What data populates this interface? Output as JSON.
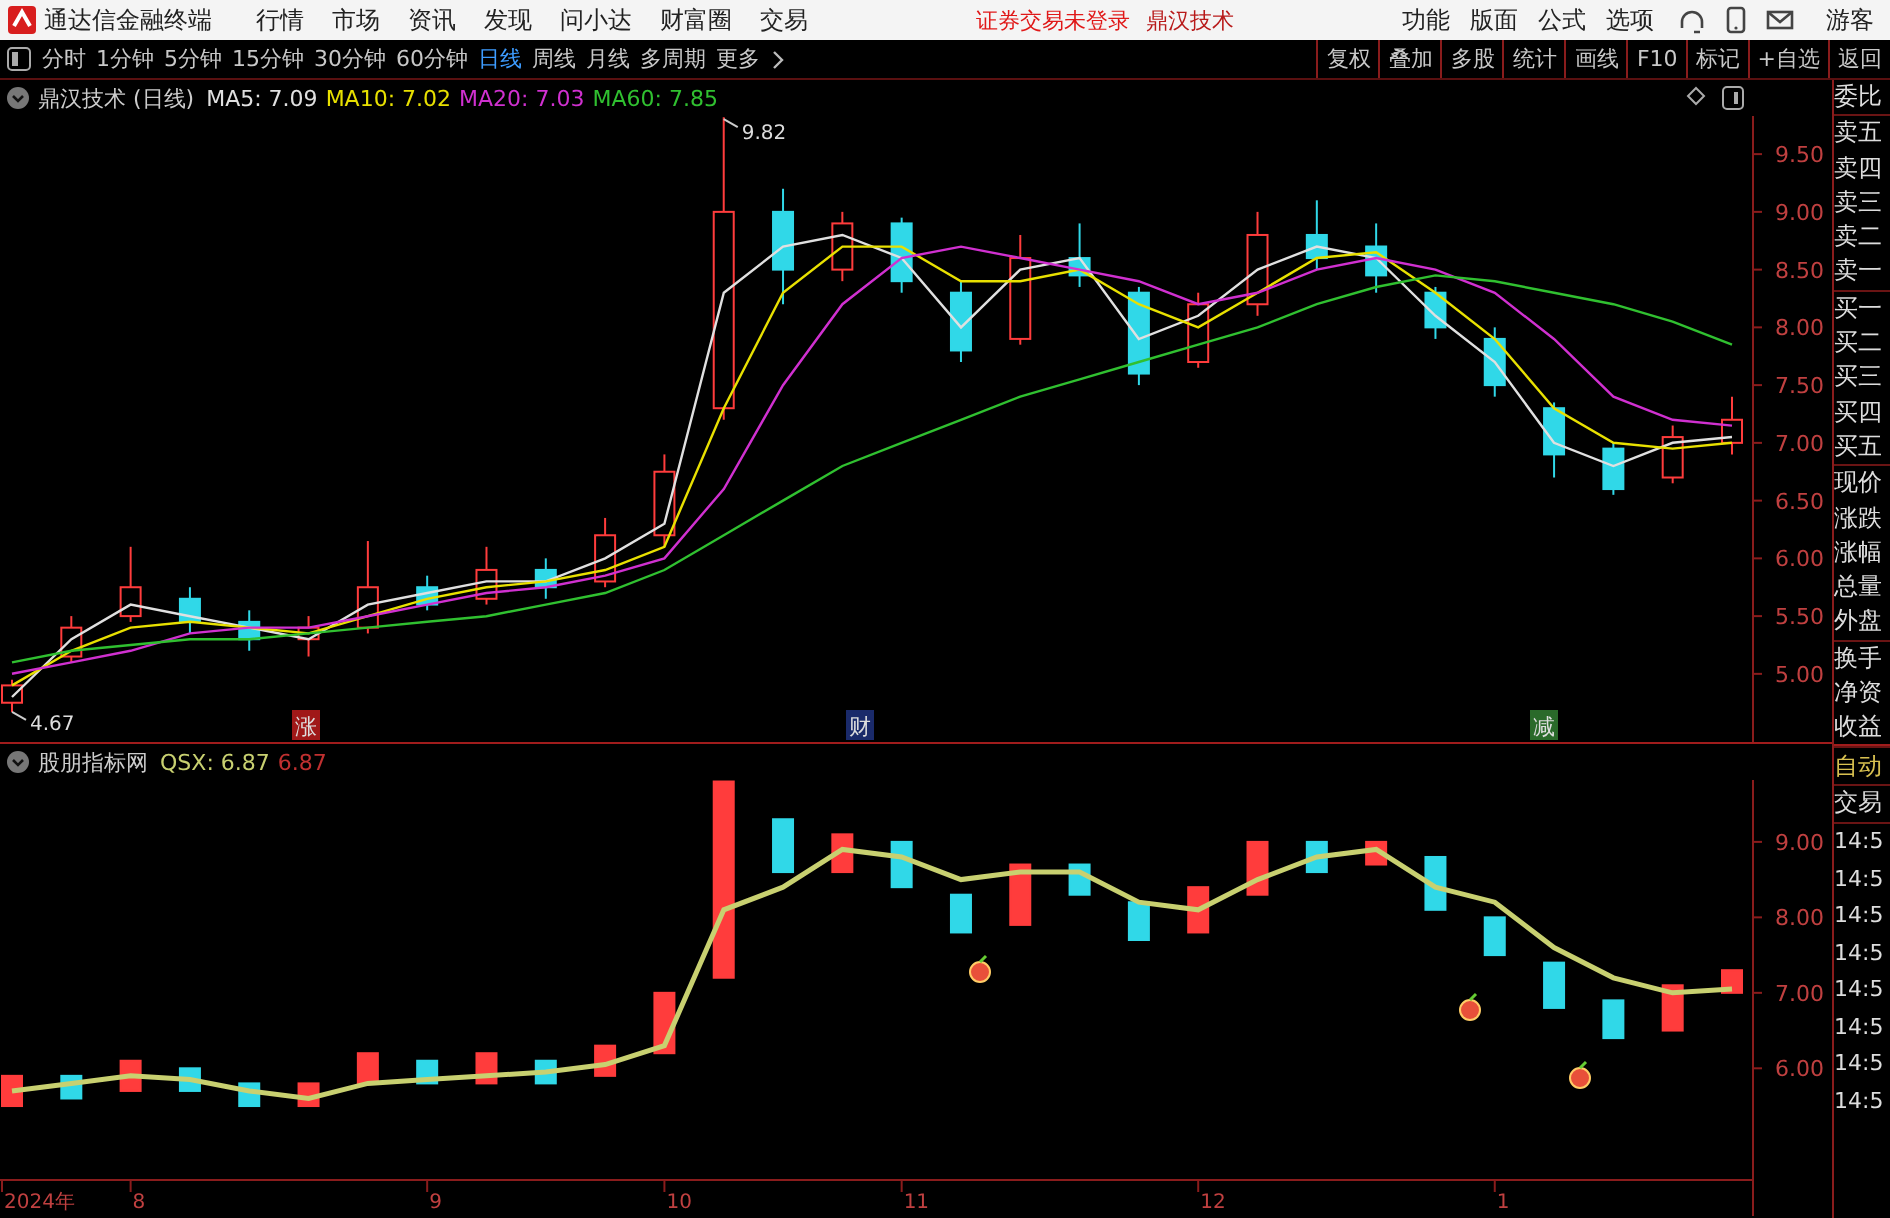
{
  "app": {
    "title": "通达信金融终端"
  },
  "menu": [
    "行情",
    "市场",
    "资讯",
    "发现",
    "问小达",
    "财富圈",
    "交易"
  ],
  "notice": [
    {
      "text": "证券交易未登录",
      "kind": "status"
    },
    {
      "text": "鼎汉技术",
      "kind": "stock"
    }
  ],
  "right_menu": [
    "功能",
    "版面",
    "公式",
    "选项"
  ],
  "user": "游客",
  "periods": [
    {
      "label": "分时",
      "selected": false
    },
    {
      "label": "1分钟",
      "selected": false
    },
    {
      "label": "5分钟",
      "selected": false
    },
    {
      "label": "15分钟",
      "selected": false
    },
    {
      "label": "30分钟",
      "selected": false
    },
    {
      "label": "60分钟",
      "selected": false
    },
    {
      "label": "日线",
      "selected": true
    },
    {
      "label": "周线",
      "selected": false
    },
    {
      "label": "月线",
      "selected": false
    },
    {
      "label": "多周期",
      "selected": false
    }
  ],
  "more": "更多",
  "tool_buttons": [
    "复权",
    "叠加",
    "多股",
    "统计",
    "画线",
    "F10",
    "标记",
    "+自选",
    "返回"
  ],
  "price_panel": {
    "title": "鼎汉技术 (日线)",
    "legend": [
      {
        "value": ": 7.09"
      },
      {
        "value": ": 7.02"
      },
      {
        "value": ": 7.03"
      },
      {
        "value": ": 7.85"
      }
    ],
    "high_label": "9.82",
    "low_label": "4.67",
    "events": [
      {
        "label": "涨",
        "color": "#a01818"
      },
      {
        "label": "财",
        "color": "#1a2a6a"
      },
      {
        "label": "减",
        "color": "#2a6a2a"
      }
    ],
    "chart_data": {
      "type": "candlestick",
      "categories": [
        null,
        null,
        null,
        null,
        null,
        null,
        null,
        null,
        null,
        null,
        null,
        null,
        null,
        null,
        null,
        null,
        null,
        null,
        null,
        null,
        null,
        null,
        null,
        null,
        null,
        null,
        null,
        null,
        null,
        null
      ],
      "ylim": [
        4.41,
        9.83
      ],
      "yticks": [
        {
          "value": 9.5,
          "label": "9.50"
        },
        {
          "value": 9,
          "label": "9.00"
        },
        {
          "value": 8.5,
          "label": "8.50"
        },
        {
          "value": 8,
          "label": "8.00"
        },
        {
          "value": 7.5,
          "label": "7.50"
        },
        {
          "value": 7,
          "label": "7.00"
        },
        {
          "value": 6.5,
          "label": "6.50"
        },
        {
          "value": 6,
          "label": "6.00"
        },
        {
          "value": 5.5,
          "label": "5.50"
        },
        {
          "value": 5,
          "label": "5.00"
        }
      ],
      "ohlc": [
        [
          4.75,
          4.95,
          4.67,
          4.9
        ],
        [
          5.15,
          5.5,
          5.1,
          5.4
        ],
        [
          5.5,
          6.1,
          5.45,
          5.75
        ],
        [
          5.65,
          5.75,
          5.35,
          5.45
        ],
        [
          5.45,
          5.55,
          5.2,
          5.3
        ],
        [
          5.3,
          5.5,
          5.15,
          5.4
        ],
        [
          5.4,
          6.15,
          5.35,
          5.75
        ],
        [
          5.75,
          5.85,
          5.55,
          5.6
        ],
        [
          5.65,
          6.1,
          5.6,
          5.9
        ],
        [
          5.9,
          6.0,
          5.65,
          5.75
        ],
        [
          5.8,
          6.35,
          5.75,
          6.2
        ],
        [
          6.2,
          6.9,
          6.1,
          6.75
        ],
        [
          7.3,
          9.82,
          7.2,
          9.0
        ],
        [
          9.0,
          9.2,
          8.2,
          8.5
        ],
        [
          8.5,
          9.0,
          8.4,
          8.9
        ],
        [
          8.9,
          8.95,
          8.3,
          8.4
        ],
        [
          8.3,
          8.4,
          7.7,
          7.8
        ],
        [
          7.9,
          8.8,
          7.85,
          8.6
        ],
        [
          8.6,
          8.9,
          8.35,
          8.45
        ],
        [
          8.3,
          8.35,
          7.5,
          7.6
        ],
        [
          7.7,
          8.3,
          7.65,
          8.2
        ],
        [
          8.2,
          9.0,
          8.1,
          8.8
        ],
        [
          8.8,
          9.1,
          8.5,
          8.6
        ],
        [
          8.7,
          8.9,
          8.3,
          8.45
        ],
        [
          8.3,
          8.35,
          7.9,
          8.0
        ],
        [
          7.9,
          8.0,
          7.4,
          7.5
        ],
        [
          7.3,
          7.35,
          6.7,
          6.9
        ],
        [
          6.95,
          7.0,
          6.55,
          6.6
        ],
        [
          6.7,
          7.15,
          6.65,
          7.05
        ],
        [
          7.0,
          7.4,
          6.9,
          7.2
        ]
      ],
      "series": [
        {
          "name": "MA5",
          "type": "line",
          "color": "#e0e0e0",
          "values": [
            4.8,
            5.3,
            5.6,
            5.5,
            5.4,
            5.3,
            5.6,
            5.7,
            5.8,
            5.8,
            6.0,
            6.3,
            8.3,
            8.7,
            8.8,
            8.6,
            8.0,
            8.5,
            8.6,
            7.9,
            8.1,
            8.5,
            8.7,
            8.6,
            8.1,
            7.7,
            7.0,
            6.8,
            7.0,
            7.05
          ]
        },
        {
          "name": "MA10",
          "type": "line",
          "color": "#e8e000",
          "values": [
            4.9,
            5.2,
            5.4,
            5.45,
            5.4,
            5.35,
            5.5,
            5.65,
            5.75,
            5.8,
            5.9,
            6.1,
            7.3,
            8.3,
            8.7,
            8.7,
            8.4,
            8.4,
            8.5,
            8.2,
            8.0,
            8.3,
            8.6,
            8.65,
            8.3,
            7.9,
            7.3,
            7.0,
            6.95,
            7.0
          ]
        },
        {
          "name": "MA20",
          "type": "line",
          "color": "#d030d0",
          "values": [
            5.0,
            5.1,
            5.2,
            5.35,
            5.4,
            5.4,
            5.5,
            5.6,
            5.7,
            5.75,
            5.85,
            6.0,
            6.6,
            7.5,
            8.2,
            8.6,
            8.7,
            8.6,
            8.5,
            8.4,
            8.2,
            8.3,
            8.5,
            8.6,
            8.5,
            8.3,
            7.9,
            7.4,
            7.2,
            7.15
          ]
        },
        {
          "name": "MA60",
          "type": "line",
          "color": "#30c030",
          "values": [
            5.1,
            5.2,
            5.25,
            5.3,
            5.3,
            5.35,
            5.4,
            5.45,
            5.5,
            5.6,
            5.7,
            5.9,
            6.2,
            6.5,
            6.8,
            7.0,
            7.2,
            7.4,
            7.55,
            7.7,
            7.85,
            8.0,
            8.2,
            8.35,
            8.45,
            8.4,
            8.3,
            8.2,
            8.05,
            7.85
          ]
        }
      ]
    }
  },
  "indicator_panel": {
    "title": "股朋指标网",
    "legend": [
      {
        "value": ": 6.87"
      }
    ],
    "extra_values": [
      {
        "label": "6.87",
        "color": "#c03030"
      }
    ],
    "chart_data": {
      "type": "candlestick",
      "categories": [
        "2024年",
        null,
        "8",
        null,
        null,
        null,
        null,
        "9",
        null,
        null,
        null,
        "10",
        null,
        null,
        null,
        "11",
        null,
        null,
        null,
        null,
        "12",
        null,
        null,
        null,
        null,
        "1",
        null,
        null,
        null,
        null
      ],
      "ylim": [
        4.52,
        9.82
      ],
      "yticks": [
        {
          "value": 9,
          "label": "9.00"
        },
        {
          "value": 8,
          "label": "8.00"
        },
        {
          "value": 7,
          "label": "7.00"
        },
        {
          "value": 6,
          "label": "6.00"
        }
      ],
      "ohlc": [
        [
          5.5,
          5.9,
          5.5,
          5.9
        ],
        [
          5.9,
          5.9,
          5.6,
          5.6
        ],
        [
          5.7,
          6.1,
          5.7,
          6.1
        ],
        [
          6.0,
          6.0,
          5.7,
          5.7
        ],
        [
          5.8,
          5.8,
          5.5,
          5.5
        ],
        [
          5.5,
          5.8,
          5.5,
          5.8
        ],
        [
          5.8,
          6.2,
          5.8,
          6.2
        ],
        [
          6.1,
          6.1,
          5.8,
          5.8
        ],
        [
          5.8,
          6.2,
          5.8,
          6.2
        ],
        [
          6.1,
          6.1,
          5.8,
          5.8
        ],
        [
          5.9,
          6.3,
          5.9,
          6.3
        ],
        [
          6.2,
          7.0,
          6.2,
          7.0
        ],
        [
          7.2,
          9.8,
          7.2,
          9.8
        ],
        [
          9.3,
          9.3,
          8.6,
          8.6
        ],
        [
          8.6,
          9.1,
          8.6,
          9.1
        ],
        [
          9.0,
          9.0,
          8.4,
          8.4
        ],
        [
          8.3,
          8.3,
          7.8,
          7.8
        ],
        [
          7.9,
          8.7,
          7.9,
          8.7
        ],
        [
          8.7,
          8.7,
          8.3,
          8.3
        ],
        [
          8.2,
          8.2,
          7.7,
          7.7
        ],
        [
          7.8,
          8.4,
          7.8,
          8.4
        ],
        [
          8.3,
          9.0,
          8.3,
          9.0
        ],
        [
          9.0,
          9.0,
          8.6,
          8.6
        ],
        [
          8.7,
          9.0,
          8.7,
          9.0
        ],
        [
          8.8,
          8.8,
          8.1,
          8.1
        ],
        [
          8.0,
          8.0,
          7.5,
          7.5
        ],
        [
          7.4,
          7.4,
          6.8,
          6.8
        ],
        [
          6.9,
          6.9,
          6.4,
          6.4
        ],
        [
          6.5,
          7.1,
          6.5,
          7.1
        ],
        [
          7.0,
          7.3,
          7.0,
          7.3
        ]
      ],
      "series": [
        {
          "name": "QSX",
          "type": "line",
          "color": "#c8d070",
          "values": [
            5.7,
            5.8,
            5.9,
            5.85,
            5.7,
            5.6,
            5.8,
            5.85,
            5.9,
            5.95,
            6.05,
            6.3,
            8.1,
            8.4,
            8.9,
            8.8,
            8.5,
            8.6,
            8.6,
            8.2,
            8.1,
            8.5,
            8.8,
            8.9,
            8.4,
            8.2,
            7.6,
            7.2,
            7.0,
            7.05
          ]
        }
      ]
    }
  },
  "quote_groups": [
    [
      "委比"
    ],
    [
      "卖五",
      "卖四",
      "卖三",
      "卖二",
      "卖一"
    ],
    [
      "买一",
      "买二",
      "买三",
      "买四",
      "买五"
    ],
    [
      "现价",
      "涨跌",
      "涨幅",
      "总量",
      "外盘"
    ],
    [
      "换手",
      "净资",
      "收益"
    ]
  ],
  "auto": "自动",
  "trade": "交易",
  "times": [
    "14:5",
    "14:5",
    "14:5",
    "14:5",
    "14:5",
    "14:5",
    "14:5",
    "14:5"
  ]
}
